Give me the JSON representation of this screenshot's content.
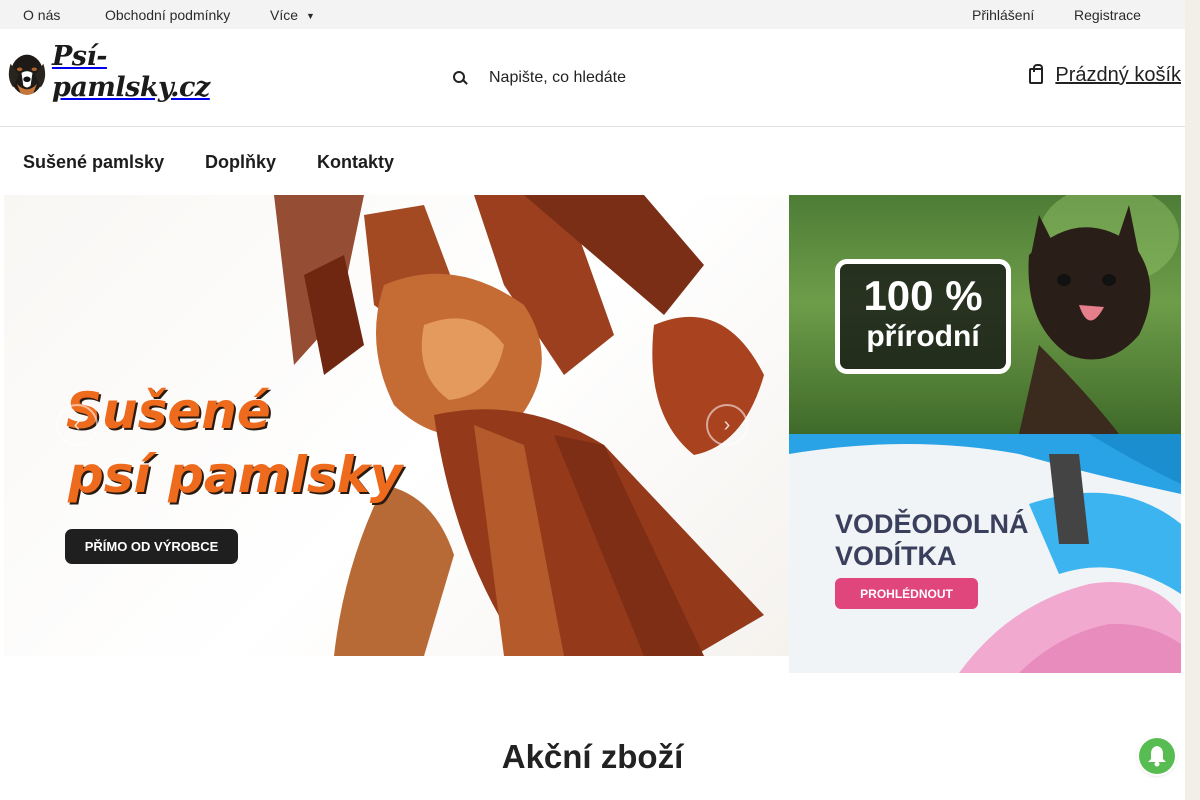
{
  "topbar": {
    "links": [
      "O nás",
      "Obchodní podmínky",
      "Více"
    ],
    "login": "Přihlášení",
    "register": "Registrace"
  },
  "header": {
    "logo_text": "Psí-pamlsky.cz",
    "search_placeholder": "Napište, co hledáte",
    "cart_label": "Prázdný košík"
  },
  "nav": {
    "items": [
      "Sušené pamlsky",
      "Doplňky",
      "Kontakty"
    ]
  },
  "hero": {
    "main": {
      "title_line1": "Sušené",
      "title_line2": "psí pamlsky",
      "button": "PŘÍMO OD VÝROBCE"
    },
    "banner_top": {
      "percent": "100 %",
      "word": "přírodní"
    },
    "banner_bottom": {
      "line1": "VODĚODOLNÁ",
      "line2": "VODÍTKA",
      "button": "PROHLÉDNOUT"
    }
  },
  "section": {
    "title": "Akční zboží"
  },
  "colors": {
    "accent_orange": "#ee6a1d",
    "button_pink": "#e0457c",
    "bell_green": "#57bd52"
  }
}
